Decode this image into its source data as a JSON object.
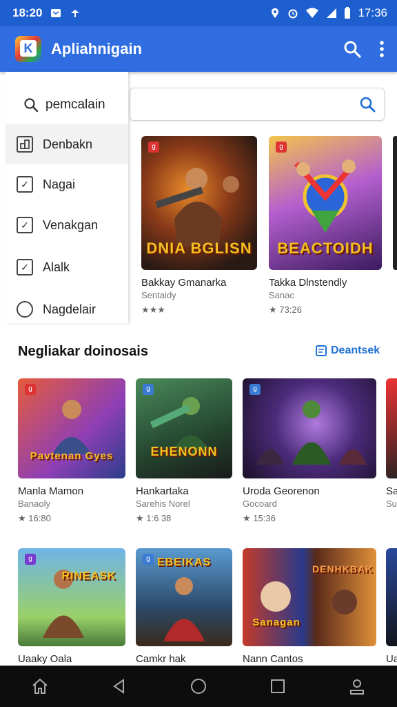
{
  "status": {
    "time": "18:20",
    "time_right": "17:36"
  },
  "app": {
    "title": "Apliahnigain"
  },
  "drawer": {
    "search_label": "pemcalain",
    "items": [
      {
        "label": "Denbakn",
        "type": "icon"
      },
      {
        "label": "Nagai",
        "type": "check"
      },
      {
        "label": "Venakgan",
        "type": "check"
      },
      {
        "label": "Alalk",
        "type": "check"
      },
      {
        "label": "Nagdelair",
        "type": "radio"
      }
    ]
  },
  "top_row": [
    {
      "name": "Bakkay Gmanarka",
      "dev": "Sentaidy",
      "rating": "★★★",
      "art_text": "DNIA BGLISN"
    },
    {
      "name": "Takka Dlnstendly",
      "dev": "Sanac",
      "rating": "★ 73:26",
      "art_text": "BEACTOIDH"
    }
  ],
  "section": {
    "title": "Negliakar doinosais",
    "link": "Deantsek"
  },
  "row2": [
    {
      "name": "Manla Mamon",
      "dev": "Banaoly",
      "rating": "★ 16:80"
    },
    {
      "name": "Hankartaka",
      "dev": "Sarehis Norel",
      "rating": "★ 1:6 38"
    },
    {
      "name": "Uroda Georenon",
      "dev": "Gocoard",
      "rating": "★ 15:36"
    },
    {
      "name": "Sa",
      "dev": "Su",
      "rating": ""
    }
  ],
  "row3": [
    {
      "name": "Uaaky Oala"
    },
    {
      "name": "Camkr hak"
    },
    {
      "name": "Nann Cantos"
    },
    {
      "name": "Ua"
    }
  ],
  "art_labels": {
    "r2_1": "Pavtenan Gyes",
    "r2_2": "EHENONN",
    "r3_1": "RINEASK",
    "r3_2": "EBEIKAS",
    "r3_3a": "Sanagan",
    "r3_3b": "DENHKBAK"
  },
  "colors": {
    "appbar": "#2f6de0",
    "statusbar": "#1e5fd0",
    "accent": "#1e6fd6"
  }
}
